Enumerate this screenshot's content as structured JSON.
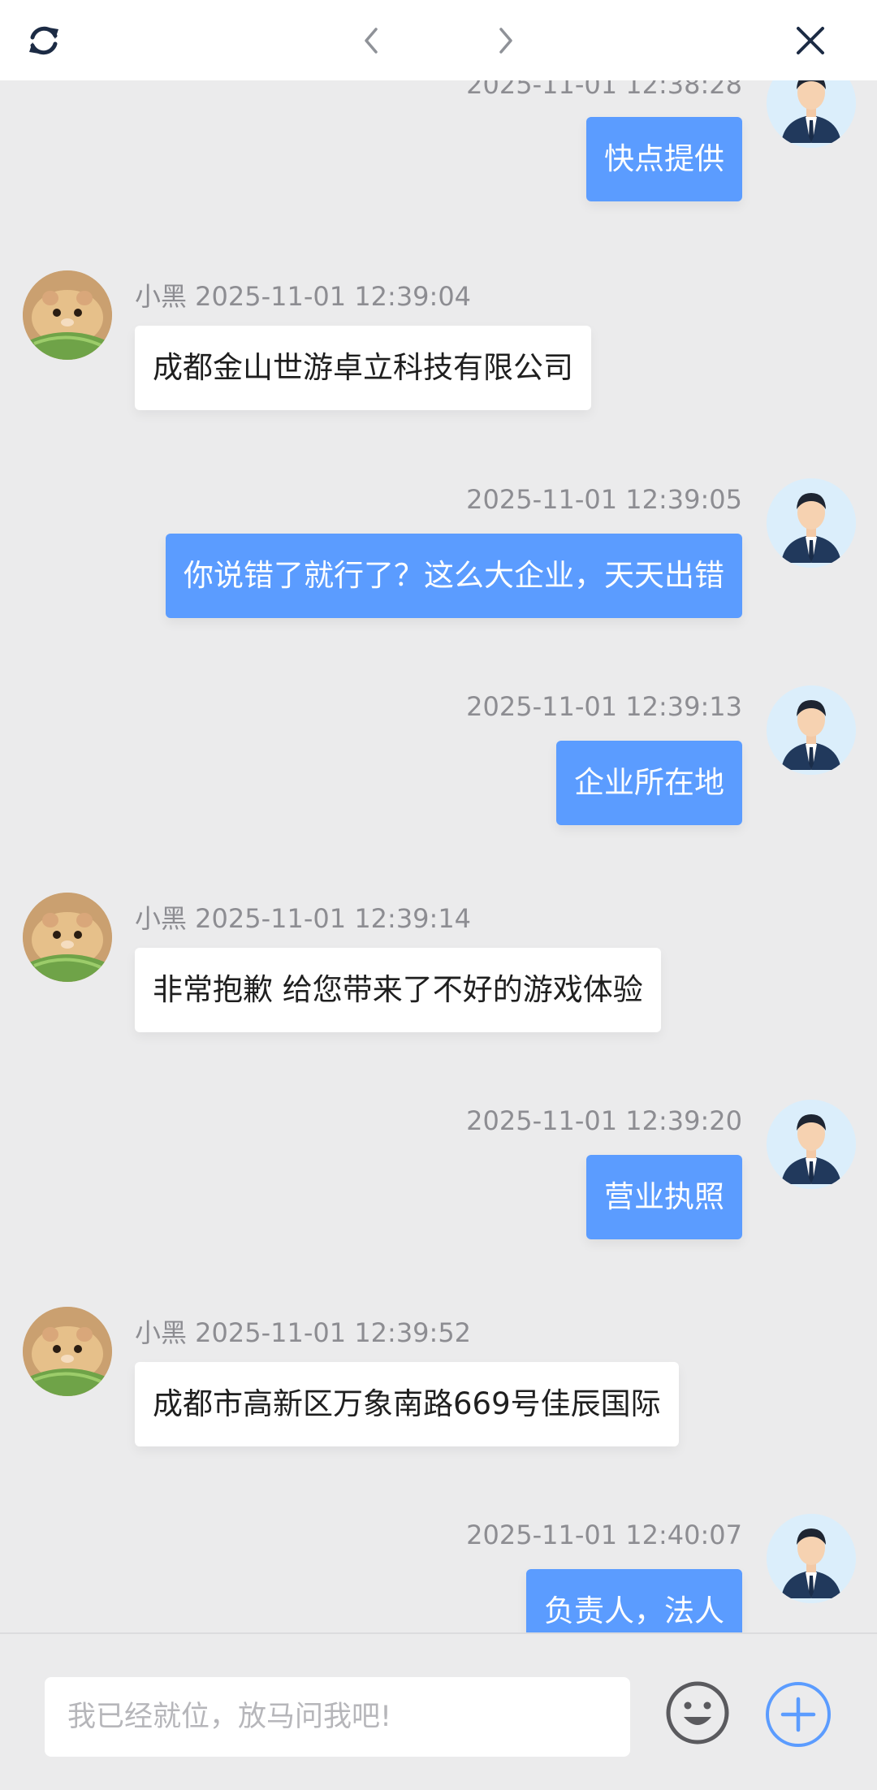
{
  "toolbar": {
    "refresh_icon": "refresh-icon",
    "back_icon": "chevron-left-icon",
    "forward_icon": "chevron-right-icon",
    "close_icon": "close-icon"
  },
  "messages": [
    {
      "side": "right",
      "meta": "2025-11-01 12:38:28",
      "text": "快点提供"
    },
    {
      "side": "left",
      "meta": "小黑 2025-11-01 12:39:04",
      "text": "成都金山世游卓立科技有限公司"
    },
    {
      "side": "right",
      "meta": "2025-11-01 12:39:05",
      "text": "你说错了就行了？这么大企业，天天出错"
    },
    {
      "side": "right",
      "meta": "2025-11-01 12:39:13",
      "text": "企业所在地"
    },
    {
      "side": "left",
      "meta": "小黑 2025-11-01 12:39:14",
      "text": "非常抱歉 给您带来了不好的游戏体验"
    },
    {
      "side": "right",
      "meta": "2025-11-01 12:39:20",
      "text": "营业执照"
    },
    {
      "side": "left",
      "meta": "小黑 2025-11-01 12:39:52",
      "text": "成都市高新区万象南路669号佳辰国际"
    },
    {
      "side": "right",
      "meta": "2025-11-01 12:40:07",
      "text": "负责人，法人"
    }
  ],
  "composer": {
    "placeholder": "我已经就位，放马问我吧!",
    "emoji_icon": "emoji-icon",
    "plus_icon": "plus-circle-icon"
  },
  "colors": {
    "accent": "#5b9cff",
    "background": "#ebebec"
  }
}
